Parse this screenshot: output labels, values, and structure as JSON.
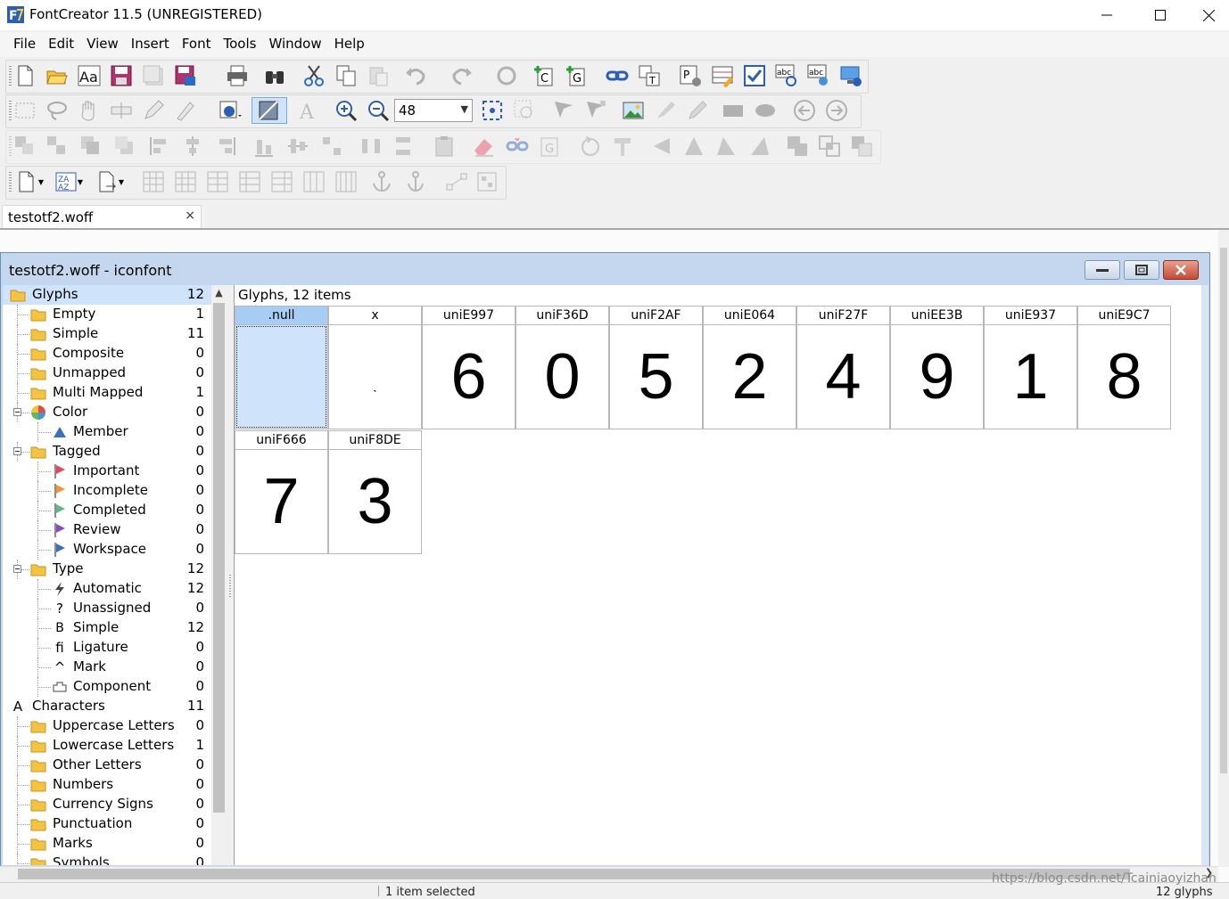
{
  "window": {
    "title": "FontCreator 11.5 (UNREGISTERED)",
    "minimize": "—",
    "maximize": "☐",
    "close": "✕"
  },
  "menu": [
    "File",
    "Edit",
    "View",
    "Insert",
    "Font",
    "Tools",
    "Window",
    "Help"
  ],
  "toolbar": {
    "zoom_value": "48"
  },
  "document_tab": {
    "label": "testotf2.woff",
    "close": "×"
  },
  "child_window": {
    "title": "testotf2.woff - iconfont"
  },
  "tree": [
    {
      "label": "Glyphs",
      "count": "12",
      "icon": "folder-icon",
      "level": 0,
      "selected": true
    },
    {
      "label": "Empty",
      "count": "1",
      "icon": "folder-icon",
      "level": 1
    },
    {
      "label": "Simple",
      "count": "11",
      "icon": "folder-icon",
      "level": 1
    },
    {
      "label": "Composite",
      "count": "0",
      "icon": "folder-icon",
      "level": 1
    },
    {
      "label": "Unmapped",
      "count": "0",
      "icon": "folder-icon",
      "level": 1
    },
    {
      "label": "Multi Mapped",
      "count": "1",
      "icon": "folder-icon",
      "level": 1
    },
    {
      "label": "Color",
      "count": "0",
      "icon": "color-wheel-icon",
      "level": 1,
      "expander": true
    },
    {
      "label": "Member",
      "count": "0",
      "icon": "triangle-icon",
      "level": 2
    },
    {
      "label": "Tagged",
      "count": "0",
      "icon": "folder-icon",
      "level": 1,
      "expander": true
    },
    {
      "label": "Important",
      "count": "0",
      "icon": "flag-red-icon",
      "level": 2
    },
    {
      "label": "Incomplete",
      "count": "0",
      "icon": "flag-orange-icon",
      "level": 2
    },
    {
      "label": "Completed",
      "count": "0",
      "icon": "flag-green-icon",
      "level": 2
    },
    {
      "label": "Review",
      "count": "0",
      "icon": "flag-purple-icon",
      "level": 2
    },
    {
      "label": "Workspace",
      "count": "0",
      "icon": "flag-blue-icon",
      "level": 2
    },
    {
      "label": "Type",
      "count": "12",
      "icon": "folder-icon",
      "level": 1,
      "expander": true
    },
    {
      "label": "Automatic",
      "count": "12",
      "icon": "lightning-icon",
      "level": 2
    },
    {
      "label": "Unassigned",
      "count": "0",
      "icon": "question-icon",
      "level": 2
    },
    {
      "label": "Simple",
      "count": "12",
      "icon": "letter-b-icon",
      "level": 2
    },
    {
      "label": "Ligature",
      "count": "0",
      "icon": "ligature-fi-icon",
      "level": 2
    },
    {
      "label": "Mark",
      "count": "0",
      "icon": "caret-mark-icon",
      "level": 2
    },
    {
      "label": "Component",
      "count": "0",
      "icon": "component-icon",
      "level": 2
    },
    {
      "label": "Characters",
      "count": "11",
      "icon": "letter-a-icon",
      "level": 0
    },
    {
      "label": "Uppercase Letters",
      "count": "0",
      "icon": "folder-icon",
      "level": 1
    },
    {
      "label": "Lowercase Letters",
      "count": "1",
      "icon": "folder-icon",
      "level": 1
    },
    {
      "label": "Other Letters",
      "count": "0",
      "icon": "folder-icon",
      "level": 1
    },
    {
      "label": "Numbers",
      "count": "0",
      "icon": "folder-icon",
      "level": 1
    },
    {
      "label": "Currency Signs",
      "count": "0",
      "icon": "folder-icon",
      "level": 1
    },
    {
      "label": "Punctuation",
      "count": "0",
      "icon": "folder-icon",
      "level": 1
    },
    {
      "label": "Marks",
      "count": "0",
      "icon": "folder-icon",
      "level": 1
    },
    {
      "label": "Symbols",
      "count": "0",
      "icon": "folder-icon",
      "level": 1
    }
  ],
  "glyph_panel": {
    "header": "Glyphs, 12 items",
    "glyphs": [
      {
        "name": ".null",
        "char": "",
        "selected": true
      },
      {
        "name": "x",
        "char": "ˋ"
      },
      {
        "name": "uniE997",
        "char": "6"
      },
      {
        "name": "uniF36D",
        "char": "0"
      },
      {
        "name": "uniF2AF",
        "char": "5"
      },
      {
        "name": "uniE064",
        "char": "2"
      },
      {
        "name": "uniF27F",
        "char": "4"
      },
      {
        "name": "uniEE3B",
        "char": "9"
      },
      {
        "name": "uniE937",
        "char": "1"
      },
      {
        "name": "uniE9C7",
        "char": "8"
      },
      {
        "name": "uniF666",
        "char": "7"
      },
      {
        "name": "uniF8DE",
        "char": "3"
      }
    ]
  },
  "status": {
    "selected": "1 item selected",
    "count": "12 glyphs"
  },
  "watermark": "https://blog.csdn.net/Tcainiaoyizhan",
  "colors": {
    "selection": "#cfe3fb",
    "folder": "#f5c342",
    "mdi_frame": "#c4d7ee",
    "close_red": "#c54a34"
  }
}
